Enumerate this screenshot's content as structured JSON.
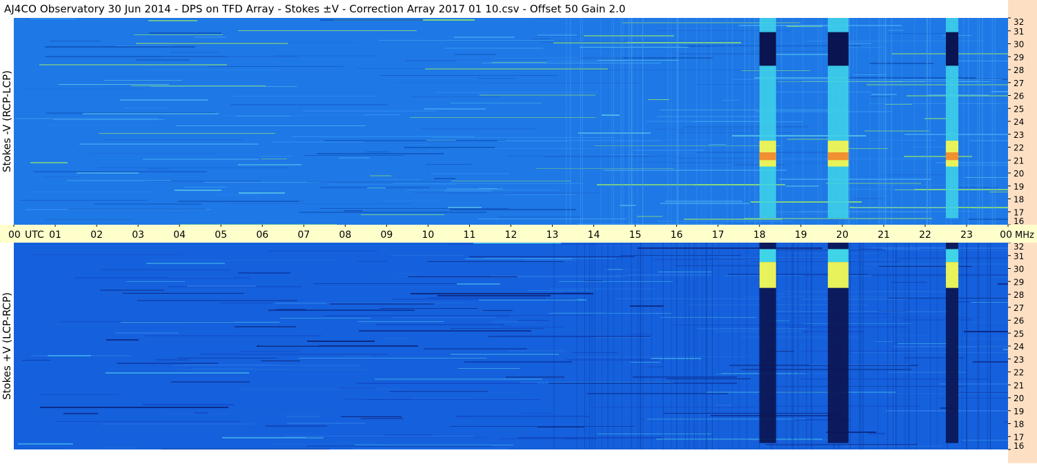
{
  "title": "AJ4CO Observatory  30 Jun 2014  -  DPS on TFD Array  -  Stokes ±V  -  Correction Array 2017 01 10.csv  -  Offset 50  Gain 2.0",
  "chart_data": [
    {
      "type": "heatmap",
      "panel": "top",
      "ylabel": "Stokes -V (RCP-LCP)",
      "x_unit": "UTC",
      "x_ticks": [
        "00",
        "01",
        "02",
        "03",
        "04",
        "05",
        "06",
        "07",
        "08",
        "09",
        "10",
        "11",
        "12",
        "13",
        "14",
        "15",
        "16",
        "17",
        "18",
        "19",
        "20",
        "21",
        "22",
        "23",
        "00"
      ],
      "y_unit": "MHz",
      "y_ticks": [
        32,
        31,
        30,
        29,
        28,
        27,
        26,
        25,
        24,
        23,
        22,
        21,
        20,
        19,
        18,
        17,
        16
      ],
      "xlim_hours": [
        0,
        24
      ],
      "ylim_mhz": [
        16,
        32
      ],
      "background_color": "#1e78e6",
      "features": [
        {
          "name": "burst-18",
          "utc_start": 18.0,
          "utc_end": 18.4,
          "low_mhz": 16.5,
          "high_mhz": 32,
          "peak_mhz": [
            20.5,
            22.5
          ]
        },
        {
          "name": "burst-20",
          "utc_start": 19.65,
          "utc_end": 20.15,
          "low_mhz": 16.5,
          "high_mhz": 32,
          "peak_mhz": [
            20.5,
            22.5
          ]
        },
        {
          "name": "burst-22-6",
          "utc_start": 22.5,
          "utc_end": 22.8,
          "low_mhz": 16.5,
          "high_mhz": 32,
          "peak_mhz": [
            20.5,
            22.5
          ]
        }
      ]
    },
    {
      "type": "heatmap",
      "panel": "bottom",
      "ylabel": "Stokes +V (LCP-RCP)",
      "x_unit": "UTC",
      "x_ticks": [
        "00",
        "01",
        "02",
        "03",
        "04",
        "05",
        "06",
        "07",
        "08",
        "09",
        "10",
        "11",
        "12",
        "13",
        "14",
        "15",
        "16",
        "17",
        "18",
        "19",
        "20",
        "21",
        "22",
        "23",
        "00"
      ],
      "y_unit": "MHz",
      "y_ticks": [
        32,
        31,
        30,
        29,
        28,
        27,
        26,
        25,
        24,
        23,
        22,
        21,
        20,
        19,
        18,
        17,
        16
      ],
      "xlim_hours": [
        0,
        24
      ],
      "ylim_mhz": [
        16,
        32
      ],
      "background_color": "#1560dc",
      "features": [
        {
          "name": "burst-18",
          "utc_start": 18.0,
          "utc_end": 18.4,
          "low_mhz": 16.5,
          "high_mhz": 32,
          "peak_mhz": [
            28.5,
            30.5
          ]
        },
        {
          "name": "burst-20",
          "utc_start": 19.65,
          "utc_end": 20.15,
          "low_mhz": 16.5,
          "high_mhz": 32,
          "peak_mhz": [
            28.5,
            30.5
          ]
        },
        {
          "name": "burst-22-6",
          "utc_start": 22.5,
          "utc_end": 22.8,
          "low_mhz": 16.5,
          "high_mhz": 32,
          "peak_mhz": [
            28.5,
            30.5
          ]
        }
      ]
    }
  ],
  "colors": {
    "top_background": "#1e78e6",
    "bottom_background": "#1560dc",
    "time_axis": "#ffffcc",
    "freq_axis": "#fde0c4",
    "burst_light": "#3fd4e8",
    "burst_hot": "#e8f25a",
    "burst_peak": "#f09030",
    "burst_dark": "#0a1450"
  }
}
